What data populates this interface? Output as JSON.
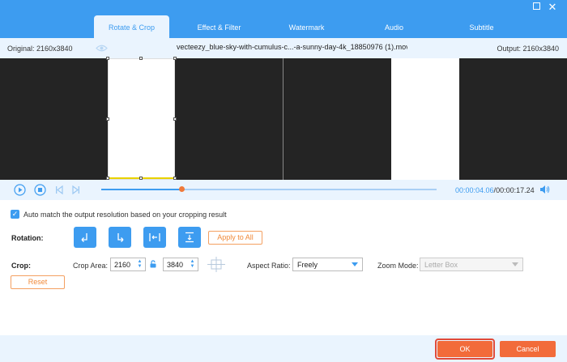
{
  "tabs": [
    {
      "label": "Rotate & Crop",
      "active": true
    },
    {
      "label": "Effect & Filter",
      "active": false
    },
    {
      "label": "Watermark",
      "active": false
    },
    {
      "label": "Audio",
      "active": false
    },
    {
      "label": "Subtitle",
      "active": false
    }
  ],
  "window": {
    "maximize_icon": "maximize-icon",
    "close_icon": "close-icon",
    "close_glyph": "✕"
  },
  "infobar": {
    "original": "Original: 2160x3840",
    "filename": "vecteezy_blue-sky-with-cumulus-c...-a-sunny-day-4k_18850976 (1).mov",
    "output": "Output: 2160x3840"
  },
  "player": {
    "progress": 0.24,
    "current_time": "00:00:04.06",
    "separator": "/",
    "total_time": "00:00:17.24"
  },
  "settings": {
    "auto_match": {
      "checked": true,
      "label": "Auto match the output resolution based on your cropping result"
    },
    "rotation_label": "Rotation:",
    "apply_to_all": "Apply to All",
    "crop_label": "Crop:",
    "crop_area_label": "Crop Area:",
    "crop_width": "2160",
    "crop_height": "3840",
    "aspect_ratio_label": "Aspect Ratio:",
    "aspect_ratio_value": "Freely",
    "zoom_mode_label": "Zoom Mode:",
    "zoom_mode_value": "Letter Box",
    "reset": "Reset"
  },
  "footer": {
    "ok": "OK",
    "cancel": "Cancel"
  },
  "colors": {
    "accent": "#3d9cf0",
    "orange": "#f26b3a",
    "light_bg": "#eaf4fe"
  }
}
